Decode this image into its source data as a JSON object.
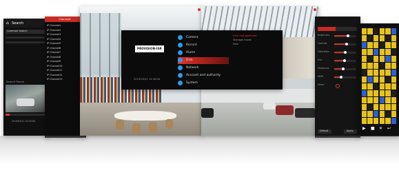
{
  "search_panel": {
    "title": "Search",
    "tab_left": "Common Search",
    "search_result_label": "Search Result",
    "status_line": "2019/03/21 15:28:08"
  },
  "channel_list": {
    "header": "Channels",
    "items": [
      "IP Channel1",
      "IP Channel2",
      "IP Channel3",
      "IP Channel4",
      "IP Channel5",
      "IP Channel6",
      "IP Channel7",
      "IP Channel8",
      "IP Channel9",
      "IP Channel10",
      "IP Channel11",
      "IP Channel12",
      "IP Channel13"
    ]
  },
  "main_menu": {
    "logo_text": "PROVISION-ISR",
    "logo_tagline": "",
    "datetime": "2019/03/21 15:28:06",
    "items": [
      {
        "label": "Camera",
        "icon": "camera-icon"
      },
      {
        "label": "Record",
        "icon": "record-icon"
      },
      {
        "label": "Alarm",
        "icon": "alarm-icon"
      },
      {
        "label": "Disk",
        "icon": "disk-icon",
        "active": true
      },
      {
        "label": "Network",
        "icon": "network-icon"
      },
      {
        "label": "Account and authority",
        "icon": "account-icon"
      },
      {
        "label": "System",
        "icon": "system-icon"
      }
    ],
    "submenu": [
      "Disk management",
      "Storage mode",
      "Disk"
    ]
  },
  "image_panel": {
    "labels": [
      "Brightness",
      "Contrast",
      "Saturation",
      "Hue",
      "Sharpness",
      "WDR",
      "Mirror"
    ],
    "levels": [
      0.62,
      0.55,
      0.5,
      0.48,
      0.4,
      0.3
    ],
    "buttons": [
      "Default",
      "Apply"
    ]
  },
  "colors": {
    "accent": "#e2312a",
    "panel_bg": "#101010",
    "timeline_yellow": "#e7c21f",
    "timeline_blue": "#2c5fd6"
  }
}
